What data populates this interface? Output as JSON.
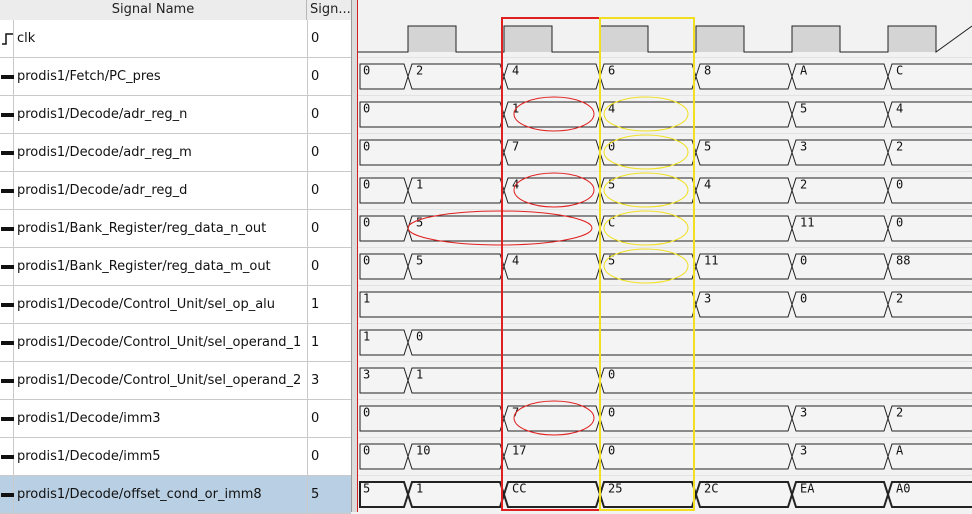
{
  "header": {
    "name_label": "Signal Name",
    "value_label": "Sign..."
  },
  "signals": [
    {
      "name": "clk",
      "value": "0",
      "type": "clock",
      "segments": []
    },
    {
      "name": "prodis1/Fetch/PC_pres",
      "value": "0",
      "type": "bus",
      "segments": [
        {
          "t": 0,
          "v": "0"
        },
        {
          "t": 1,
          "v": "2"
        },
        {
          "t": 3,
          "v": "4"
        },
        {
          "t": 5,
          "v": "6"
        },
        {
          "t": 7,
          "v": "8"
        },
        {
          "t": 9,
          "v": "A"
        },
        {
          "t": 11,
          "v": "C"
        }
      ]
    },
    {
      "name": "prodis1/Decode/adr_reg_n",
      "value": "0",
      "type": "bus",
      "segments": [
        {
          "t": 0,
          "v": "0"
        },
        {
          "t": 3,
          "v": "1"
        },
        {
          "t": 5,
          "v": "4"
        },
        {
          "t": 9,
          "v": "5"
        },
        {
          "t": 11,
          "v": "4"
        }
      ]
    },
    {
      "name": "prodis1/Decode/adr_reg_m",
      "value": "0",
      "type": "bus",
      "segments": [
        {
          "t": 0,
          "v": "0"
        },
        {
          "t": 3,
          "v": "7"
        },
        {
          "t": 5,
          "v": "0"
        },
        {
          "t": 7,
          "v": "5"
        },
        {
          "t": 9,
          "v": "3"
        },
        {
          "t": 11,
          "v": "2"
        }
      ]
    },
    {
      "name": "prodis1/Decode/adr_reg_d",
      "value": "0",
      "type": "bus",
      "segments": [
        {
          "t": 0,
          "v": "0"
        },
        {
          "t": 1,
          "v": "1"
        },
        {
          "t": 3,
          "v": "4"
        },
        {
          "t": 5,
          "v": "5"
        },
        {
          "t": 7,
          "v": "4"
        },
        {
          "t": 9,
          "v": "2"
        },
        {
          "t": 11,
          "v": "0"
        }
      ]
    },
    {
      "name": "prodis1/Bank_Register/reg_data_n_out",
      "value": "0",
      "type": "bus",
      "segments": [
        {
          "t": 0,
          "v": "0"
        },
        {
          "t": 1,
          "v": "5"
        },
        {
          "t": 5,
          "v": "C"
        },
        {
          "t": 9,
          "v": "11"
        },
        {
          "t": 11,
          "v": "0"
        }
      ]
    },
    {
      "name": "prodis1/Bank_Register/reg_data_m_out",
      "value": "0",
      "type": "bus",
      "segments": [
        {
          "t": 0,
          "v": "0"
        },
        {
          "t": 1,
          "v": "5"
        },
        {
          "t": 3,
          "v": "4"
        },
        {
          "t": 5,
          "v": "5"
        },
        {
          "t": 7,
          "v": "11"
        },
        {
          "t": 9,
          "v": "0"
        },
        {
          "t": 11,
          "v": "88"
        }
      ]
    },
    {
      "name": "prodis1/Decode/Control_Unit/sel_op_alu",
      "value": "1",
      "type": "bus",
      "segments": [
        {
          "t": 0,
          "v": "1"
        },
        {
          "t": 7,
          "v": "3"
        },
        {
          "t": 9,
          "v": "0"
        },
        {
          "t": 11,
          "v": "2"
        }
      ]
    },
    {
      "name": "prodis1/Decode/Control_Unit/sel_operand_1",
      "value": "1",
      "type": "bus",
      "segments": [
        {
          "t": 0,
          "v": "1"
        },
        {
          "t": 1,
          "v": "0"
        }
      ]
    },
    {
      "name": "prodis1/Decode/Control_Unit/sel_operand_2",
      "value": "3",
      "type": "bus",
      "segments": [
        {
          "t": 0,
          "v": "3"
        },
        {
          "t": 1,
          "v": "1"
        },
        {
          "t": 5,
          "v": "0"
        }
      ]
    },
    {
      "name": "prodis1/Decode/imm3",
      "value": "0",
      "type": "bus",
      "segments": [
        {
          "t": 0,
          "v": "0"
        },
        {
          "t": 3,
          "v": "7"
        },
        {
          "t": 5,
          "v": "0"
        },
        {
          "t": 9,
          "v": "3"
        },
        {
          "t": 11,
          "v": "2"
        }
      ]
    },
    {
      "name": "prodis1/Decode/imm5",
      "value": "0",
      "type": "bus",
      "segments": [
        {
          "t": 0,
          "v": "0"
        },
        {
          "t": 1,
          "v": "10"
        },
        {
          "t": 3,
          "v": "17"
        },
        {
          "t": 5,
          "v": "0"
        },
        {
          "t": 9,
          "v": "3"
        },
        {
          "t": 11,
          "v": "A"
        }
      ]
    },
    {
      "name": "prodis1/Decode/offset_cond_or_imm8",
      "value": "5",
      "type": "bus",
      "selected": true,
      "segments": [
        {
          "t": 0,
          "v": "5"
        },
        {
          "t": 1,
          "v": "1"
        },
        {
          "t": 3,
          "v": "CC"
        },
        {
          "t": 5,
          "v": "25"
        },
        {
          "t": 7,
          "v": "2C"
        },
        {
          "t": 9,
          "v": "EA"
        },
        {
          "t": 11,
          "v": "A0"
        }
      ]
    }
  ],
  "highlights": {
    "red_box_color": "#e02020",
    "yellow_box_color": "#f0e020",
    "red_ellipses_signals": [
      "prodis1/Decode/adr_reg_n",
      "prodis1/Decode/adr_reg_d",
      "prodis1/Bank_Register/reg_data_n_out",
      "prodis1/Decode/imm3"
    ],
    "yellow_ellipses_signals": [
      "prodis1/Decode/adr_reg_n",
      "prodis1/Decode/adr_reg_m",
      "prodis1/Decode/adr_reg_d",
      "prodis1/Bank_Register/reg_data_n_out",
      "prodis1/Bank_Register/reg_data_m_out"
    ]
  },
  "colors": {
    "selected_row": "#b9cfe3",
    "wave_fill": "#d4d4d4",
    "wave_line": "#222222"
  }
}
